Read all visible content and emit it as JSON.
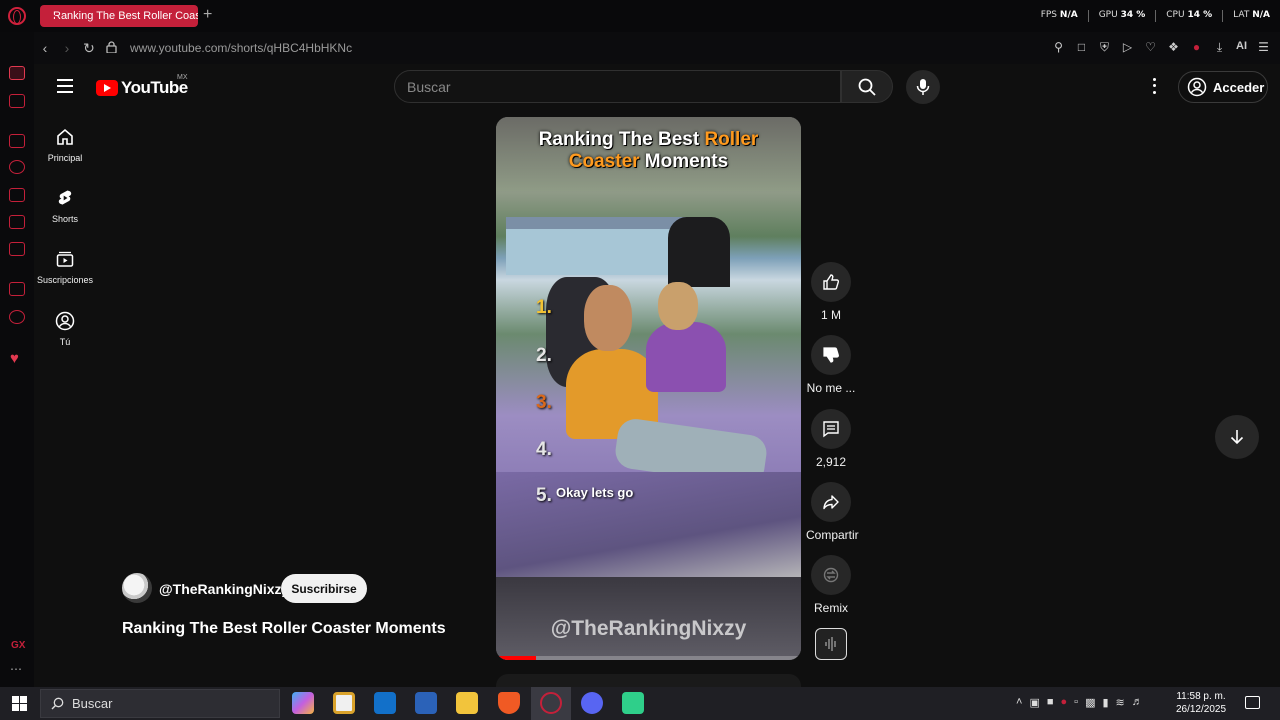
{
  "browser": {
    "tab_title": "Ranking The Best Roller Coaster Moments - YouTube",
    "new_tab_symbol": "+",
    "url": "www.youtube.com/shorts/qHBC4HbHKNc",
    "perf": {
      "fps_label": "FPS",
      "fps_value": "N/A",
      "gpu_label": "GPU",
      "gpu_value": "34 %",
      "cpu_label": "CPU",
      "cpu_value": "14 %",
      "lat_label": "LAT",
      "lat_value": "N/A"
    },
    "ai_label": "AI"
  },
  "youtube": {
    "logo_text": "YouTube",
    "region": "MX",
    "search_placeholder": "Buscar",
    "signin_label": "Acceder",
    "guide": [
      {
        "label": "Principal"
      },
      {
        "label": "Shorts"
      },
      {
        "label": "Suscripciones"
      },
      {
        "label": "Tú"
      }
    ]
  },
  "short": {
    "overlay_title_line1_white": "Ranking The Best ",
    "overlay_title_line1_orange": "Roller",
    "overlay_title_line2_orange": "Coaster",
    "overlay_title_line2_white": " Moments",
    "numbers": [
      "1.",
      "2.",
      "3.",
      "4.",
      "5."
    ],
    "caption": "Okay lets go",
    "watermark": "@TheRankingNixzy",
    "progress_fraction": 0.13,
    "channel": "@TheRankingNixzy",
    "subscribe_label": "Suscribirse",
    "title": "Ranking The Best Roller Coaster Moments"
  },
  "actions": {
    "like_count": "1 M",
    "dislike_label": "No me ...",
    "comment_count": "2,912",
    "share_label": "Compartir",
    "remix_label": "Remix"
  },
  "taskbar": {
    "search_label": "Buscar",
    "time": "11:58 p. m.",
    "date": "26/12/2025"
  },
  "colors": {
    "youtube_red": "#ff0000",
    "opera_red": "#c4203a",
    "title_orange": "#ff9a1e"
  }
}
